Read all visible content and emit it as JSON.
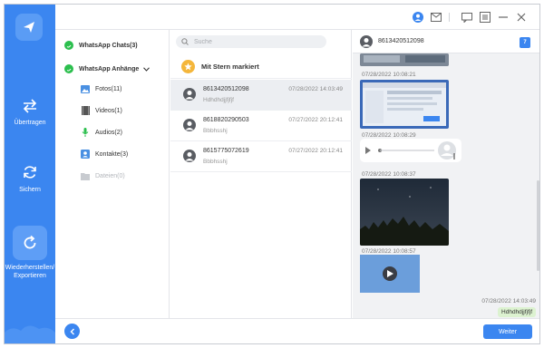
{
  "sidebar": {
    "items": [
      {
        "label": "Übertragen",
        "icon": "transfer-icon"
      },
      {
        "label": "Sichern",
        "icon": "backup-icon"
      },
      {
        "label": "Wiederherstellen/ Exportieren",
        "icon": "restore-icon",
        "active": true
      }
    ]
  },
  "categories": {
    "chats": "WhatsApp Chats(3)",
    "attachments": "WhatsApp Anhänge",
    "photos": "Fotos(11)",
    "videos": "Videos(1)",
    "audios": "Audios(2)",
    "contacts": "Kontakte(3)",
    "files": "Dateien(0)"
  },
  "search": {
    "placeholder": "Suche"
  },
  "starred_label": "Mit Stern markiert",
  "chats": [
    {
      "name": "8613420512098",
      "snippet": "Hdhdhdjjfjfjf",
      "time": "07/28/2022 14:03:49",
      "selected": true
    },
    {
      "name": "8618820290503",
      "snippet": "Bbbhsshj",
      "time": "07/27/2022 20:12:41"
    },
    {
      "name": "8615775072619",
      "snippet": "Bbbhsshj",
      "time": "07/27/2022 20:12:41"
    }
  ],
  "conversation": {
    "title": "8613420512098",
    "calendar_day": "7",
    "timestamps": [
      "07/28/2022 10:08:21",
      "07/28/2022 10:08:29",
      "07/28/2022 10:08:37",
      "07/28/2022 10:08:57",
      "07/28/2022 14:03:49"
    ],
    "last_message": "Hdhdhdjjfjfjf"
  },
  "footer": {
    "next_label": "Weiter"
  },
  "colors": {
    "accent": "#3b86f0",
    "star": "#f4b63b",
    "bubble": "#dcf2d0"
  }
}
